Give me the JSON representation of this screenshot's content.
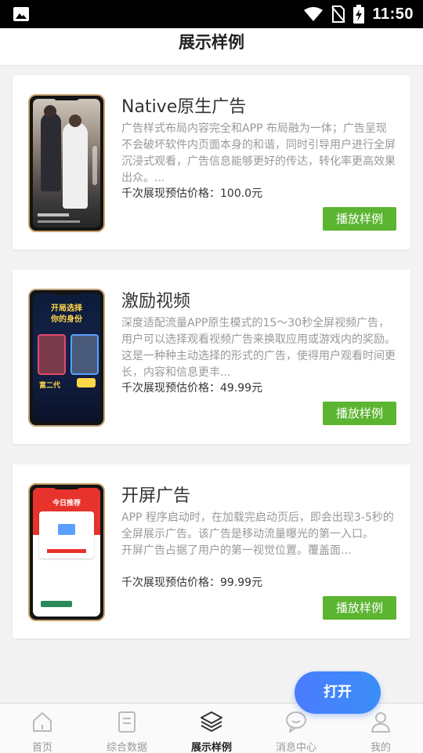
{
  "status_bar": {
    "time": "11:50"
  },
  "header": {
    "title": "展示样例"
  },
  "cards": [
    {
      "title": "Native原生广告",
      "description": "广告样式布局内容完全和APP 布局融为一体；广告呈现不会破坏软件内页面本身的和谐，同时引导用户进行全屏沉浸式观看，广告信息能够更好的传达，转化率更高效果出众。...",
      "price": "千次展现预估价格：100.0元",
      "button": "播放样例"
    },
    {
      "title": "激励视频",
      "description": "深度适配流量APP原生模式的15～30秒全屏视频广告，用户可以选择观看视频广告来换取应用或游戏内的奖励。这是一种种主动选择的形式的广告，使得用户观看时间更长，内容和信息更丰...",
      "price": "千次展现预估价格：49.99元",
      "button": "播放样例",
      "preview_text": [
        "开局选择",
        "你的身份",
        "富二代"
      ]
    },
    {
      "title": "开屏广告",
      "description": "APP 程序启动时，在加载完启动页后，即会出现3-5秒的全屏展示广告。该广告是移动流量曝光的第一入口。\n开屏广告占据了用户的第一视觉位置。覆盖面...",
      "price": "千次展现预估价格：99.99元",
      "button": "播放样例",
      "preview_text": [
        "今日推荐"
      ]
    }
  ],
  "float_button": {
    "label": "打开"
  },
  "tabs": [
    {
      "label": "首页",
      "icon": "home-icon",
      "active": false
    },
    {
      "label": "综合数据",
      "icon": "document-icon",
      "active": false
    },
    {
      "label": "展示样例",
      "icon": "layers-icon",
      "active": true
    },
    {
      "label": "消息中心",
      "icon": "chat-icon",
      "active": false
    },
    {
      "label": "我的",
      "icon": "user-icon",
      "active": false
    }
  ],
  "colors": {
    "accent_green": "#5cb531",
    "accent_blue": "#4b7cff",
    "frame_gold": "#c9a36d"
  }
}
